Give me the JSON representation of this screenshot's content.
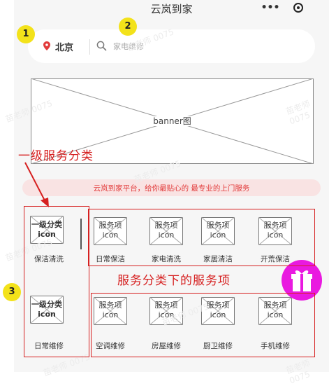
{
  "app": {
    "title": "云岚到家"
  },
  "search": {
    "city": "北京",
    "placeholder": "家电维修"
  },
  "banner": {
    "label": "banner图"
  },
  "slogan": "云岚到家平台，给你最贴心的 最专业的上门服务",
  "categories": [
    {
      "icon_text": "一级分类icon",
      "label": "保洁清洗"
    },
    {
      "icon_text": "一级分类icon",
      "label": "日常维修"
    }
  ],
  "service_rows": [
    {
      "items": [
        {
          "icon_text": "服务项icon",
          "label": "日常保洁"
        },
        {
          "icon_text": "服务项icon",
          "label": "家电清洗"
        },
        {
          "icon_text": "服务项icon",
          "label": "家居清洁"
        },
        {
          "icon_text": "服务项icon",
          "label": "开荒保洁"
        }
      ]
    },
    {
      "items": [
        {
          "icon_text": "服务项icon",
          "label": "空调维修"
        },
        {
          "icon_text": "服务项icon",
          "label": "房屋维修"
        },
        {
          "icon_text": "服务项icon",
          "label": "厨卫维修"
        },
        {
          "icon_text": "服务项icon",
          "label": "手机维修"
        }
      ]
    }
  ],
  "annotations": {
    "badges": [
      "1",
      "2",
      "3"
    ],
    "first_level_note": "一级服务分类",
    "service_items_note": "服务分类下的服务项"
  },
  "watermark": "苗老师 0075",
  "colors": {
    "accent_red": "#d62020",
    "gift_magenta": "#e919e0",
    "badge_yellow": "#f3e21a",
    "slogan_bg": "#f9e3e3"
  },
  "icons": [
    "more-icon",
    "record-icon",
    "location-pin-icon",
    "search-icon",
    "gift-icon"
  ]
}
